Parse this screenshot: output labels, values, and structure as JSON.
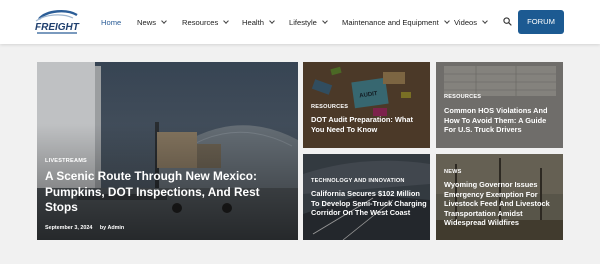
{
  "brand": {
    "logo_text": "FREIGHT"
  },
  "nav": {
    "items": [
      {
        "label": "Home"
      },
      {
        "label": "News"
      },
      {
        "label": "Resources"
      },
      {
        "label": "Health"
      },
      {
        "label": "Lifestyle"
      },
      {
        "label": "Maintenance and Equipment"
      },
      {
        "label": "Videos"
      }
    ],
    "forum_label": "FORUM"
  },
  "featured": {
    "category": "LIVESTREAMS",
    "title": "A Scenic Route Through New Mexico: Pumpkins, DOT Inspections, And Rest Stops",
    "date": "September 3, 2024",
    "author": "by Admin"
  },
  "cards": [
    {
      "category": "RESOURCES",
      "title": "DOT Audit Preparation: What You Need To Know",
      "image_text": "AUDIT"
    },
    {
      "category": "RESOURCES",
      "title": "Common HOS Violations And How To Avoid Them: A Guide For U.S. Truck Drivers"
    },
    {
      "category": "TECHNOLOGY AND INNOVATION",
      "title": "California Secures $102 Million To Develop Semi-Truck Charging Corridor On The West Coast"
    },
    {
      "category": "NEWS",
      "title": "Wyoming Governor Issues Emergency Exemption For Livestock Feed And Livestock Transportation Amidst Widespread Wildfires"
    }
  ],
  "colors": {
    "accent": "#1c5a92",
    "nav_active": "#2b5d97"
  },
  "icons": {
    "search": "search-icon"
  }
}
